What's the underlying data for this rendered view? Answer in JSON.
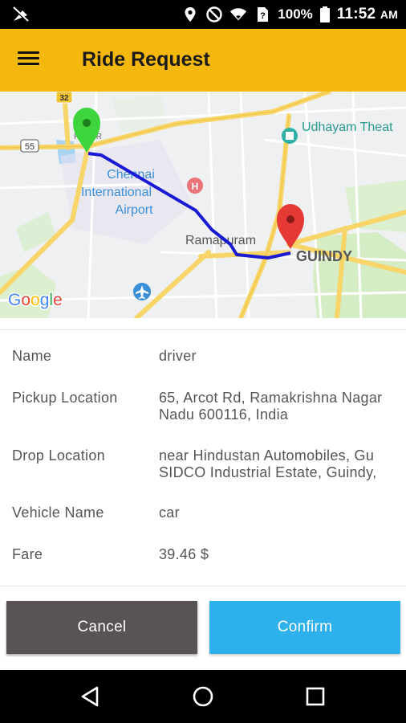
{
  "status_bar": {
    "left_icon": "signal-off-icon",
    "icons": [
      "location-icon",
      "do-not-disturb-icon",
      "wifi-icon",
      "sim-card-icon"
    ],
    "battery": "100%",
    "time": "11:52",
    "ampm": "AM"
  },
  "app_bar": {
    "menu_icon": "hamburger-menu-icon",
    "title": "Ride Request"
  },
  "map": {
    "labels": {
      "airport": [
        "Chennai",
        "International",
        "Airport"
      ],
      "ramapuram": "Ramapuram",
      "guindy": "GUINDY",
      "udhayam": "Udhayam Theat",
      "route_32": "32",
      "route_55": "55",
      "pozur": "POZUR",
      "hospital": "H"
    },
    "logo": "Google",
    "pickup_marker_color": "#3ed43e",
    "drop_marker_color": "#e53935",
    "route_color": "#1a1ad4"
  },
  "details": {
    "name_label": "Name",
    "name_value": "driver",
    "pickup_label": "Pickup Location",
    "pickup_value_line1": "65, Arcot Rd, Ramakrishna Nagar",
    "pickup_value_line2": "Nadu 600116, India",
    "drop_label": "Drop Location",
    "drop_value_line1": "near Hindustan Automobiles, Gu",
    "drop_value_line2": "SIDCO Industrial Estate, Guindy,",
    "vehicle_label": "Vehicle Name",
    "vehicle_value": "car",
    "fare_label": "Fare",
    "fare_value": "39.46 $"
  },
  "buttons": {
    "cancel": "Cancel",
    "confirm": "Confirm"
  },
  "nav_bar": {
    "back": "back-icon",
    "home": "home-icon",
    "recents": "recents-icon"
  }
}
